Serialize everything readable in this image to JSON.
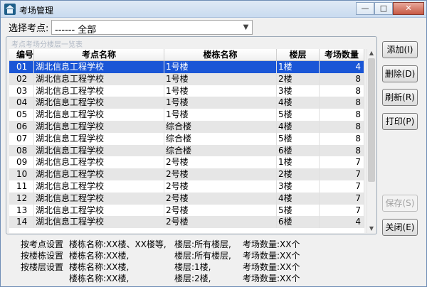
{
  "window": {
    "title": "考场管理",
    "minimize": "—",
    "maximize": "□",
    "close": "✕"
  },
  "filter": {
    "label": "选择考点:",
    "selected": "------ 全部"
  },
  "group": {
    "caption": "考点考场分楼层一览表"
  },
  "table": {
    "columns": [
      "编号",
      "考点名称",
      "楼栋名称",
      "楼层",
      "考场数量"
    ],
    "rows": [
      [
        "01",
        "湖北信息工程学校",
        "1号楼",
        "1楼",
        "4"
      ],
      [
        "02",
        "湖北信息工程学校",
        "1号楼",
        "2楼",
        "8"
      ],
      [
        "03",
        "湖北信息工程学校",
        "1号楼",
        "3楼",
        "8"
      ],
      [
        "04",
        "湖北信息工程学校",
        "1号楼",
        "4楼",
        "8"
      ],
      [
        "05",
        "湖北信息工程学校",
        "1号楼",
        "5楼",
        "8"
      ],
      [
        "06",
        "湖北信息工程学校",
        "综合楼",
        "4楼",
        "8"
      ],
      [
        "07",
        "湖北信息工程学校",
        "综合楼",
        "5楼",
        "8"
      ],
      [
        "08",
        "湖北信息工程学校",
        "综合楼",
        "6楼",
        "8"
      ],
      [
        "09",
        "湖北信息工程学校",
        "2号楼",
        "1楼",
        "7"
      ],
      [
        "10",
        "湖北信息工程学校",
        "2号楼",
        "2楼",
        "7"
      ],
      [
        "11",
        "湖北信息工程学校",
        "2号楼",
        "3楼",
        "7"
      ],
      [
        "12",
        "湖北信息工程学校",
        "2号楼",
        "4楼",
        "7"
      ],
      [
        "13",
        "湖北信息工程学校",
        "2号楼",
        "5楼",
        "7"
      ],
      [
        "14",
        "湖北信息工程学校",
        "2号楼",
        "6楼",
        "4"
      ]
    ]
  },
  "buttons": {
    "add": "添加(I)",
    "delete": "删除(D)",
    "refresh": "刷新(R)",
    "print": "打印(P)",
    "save": "保存(S)",
    "close": "关闭(E)"
  },
  "help": {
    "col1": [
      "按考点设置",
      "按楼栋设置",
      "按楼层设置",
      ""
    ],
    "col2": [
      "楼栋名称:XX楼、XX楼等,",
      "楼栋名称:XX楼,",
      "楼栋名称:XX楼,",
      "楼栋名称:XX楼,"
    ],
    "col3": [
      "楼层:所有楼层,",
      "楼层:所有楼层,",
      "楼层:1楼,",
      "楼层:2楼,"
    ],
    "col4": [
      "考场数量:XX个",
      "考场数量:XX个",
      "考场数量:XX个",
      "考场数量:XX个"
    ]
  }
}
